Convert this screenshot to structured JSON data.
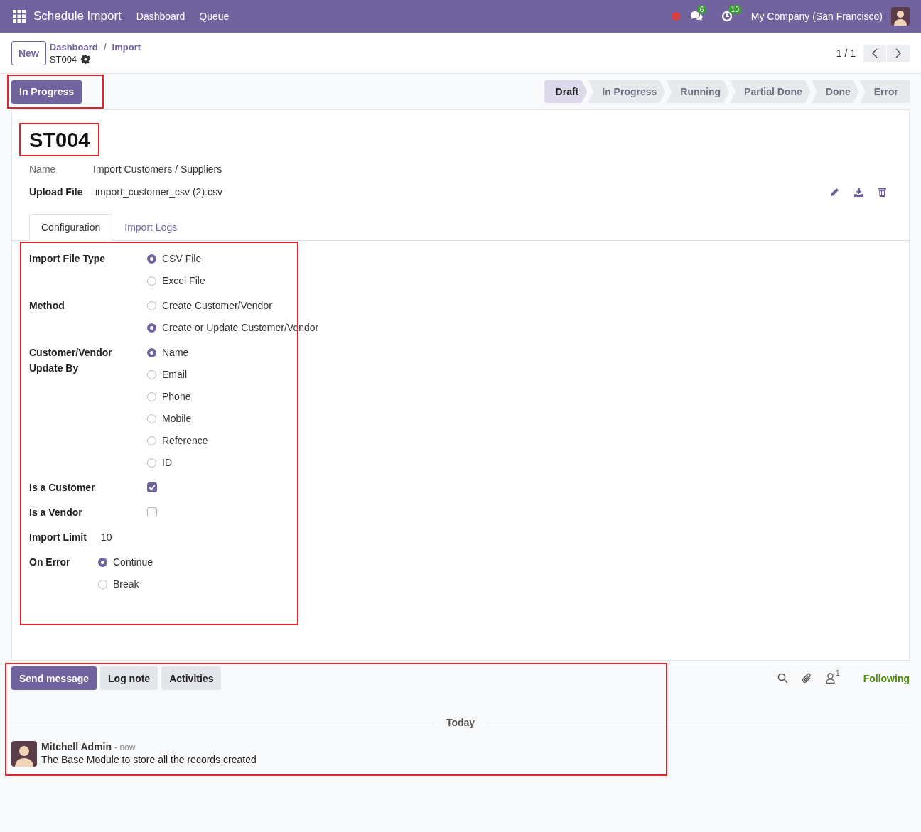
{
  "navbar": {
    "app_title": "Schedule Import",
    "menu": [
      "Dashboard",
      "Queue"
    ],
    "messages_badge": "6",
    "activities_badge": "10",
    "company": "My Company (San Francisco)"
  },
  "control_panel": {
    "new_button": "New",
    "breadcrumbs": [
      "Dashboard",
      "Import"
    ],
    "breadcrumb_separator": "/",
    "record": "ST004",
    "pager": "1 / 1"
  },
  "header": {
    "action_button": {
      "label": "In Progress",
      "highlight": true
    },
    "stages": [
      {
        "label": "Draft",
        "selected": true
      },
      {
        "label": "In Progress",
        "selected": false
      },
      {
        "label": "Running",
        "selected": false
      },
      {
        "label": "Partial Done",
        "selected": false
      },
      {
        "label": "Done",
        "selected": false
      },
      {
        "label": "Error",
        "selected": false
      }
    ]
  },
  "form": {
    "title": {
      "text": "ST004",
      "highlight": true
    },
    "fields": [
      {
        "label": "Name",
        "value": "Import Customers / Suppliers",
        "bold_label": false
      },
      {
        "label": "Upload File",
        "value": "import_customer_csv (2).csv",
        "bold_label": true
      }
    ],
    "tabs": [
      {
        "label": "Configuration",
        "selected": true
      },
      {
        "label": "Import Logs",
        "selected": false
      }
    ],
    "config_highlight": true,
    "groups": [
      {
        "fields": [
          {
            "kind": "radio",
            "label": "Import File Type",
            "options": [
              {
                "label": "CSV File",
                "selected": true
              },
              {
                "label": "Excel File",
                "selected": false
              }
            ]
          },
          {
            "kind": "radio",
            "label": "Method",
            "options": [
              {
                "label": "Create Customer/Vendor",
                "selected": false
              },
              {
                "label": "Create or Update Customer/Vendor",
                "selected": true
              }
            ]
          },
          {
            "kind": "radio",
            "label": "Customer/Vendor Update By",
            "options": [
              {
                "label": "Name",
                "selected": true
              },
              {
                "label": "Email",
                "selected": false
              },
              {
                "label": "Phone",
                "selected": false
              },
              {
                "label": "Mobile",
                "selected": false
              },
              {
                "label": "Reference",
                "selected": false
              },
              {
                "label": "ID",
                "selected": false
              }
            ]
          },
          {
            "kind": "checkbox",
            "label": "Is a Customer",
            "checked": true
          },
          {
            "kind": "checkbox",
            "label": "Is a Vendor",
            "checked": false
          }
        ]
      },
      {
        "fields": [
          {
            "kind": "text",
            "label": "Import Limit",
            "value": "10"
          },
          {
            "kind": "radio",
            "label": "On Error",
            "options": [
              {
                "label": "Continue",
                "selected": true
              },
              {
                "label": "Break",
                "selected": false
              }
            ]
          }
        ]
      }
    ]
  },
  "chatter": {
    "highlight": true,
    "buttons": [
      {
        "label": "Send message",
        "primary": true
      },
      {
        "label": "Log note",
        "primary": false
      },
      {
        "label": "Activities",
        "primary": false
      }
    ],
    "followers_count": "1",
    "follow_label": "Following",
    "date_separator": "Today",
    "messages": [
      {
        "author": "Mitchell Admin",
        "time": "- now",
        "body": "The Base Module to store all the records created"
      }
    ]
  }
}
